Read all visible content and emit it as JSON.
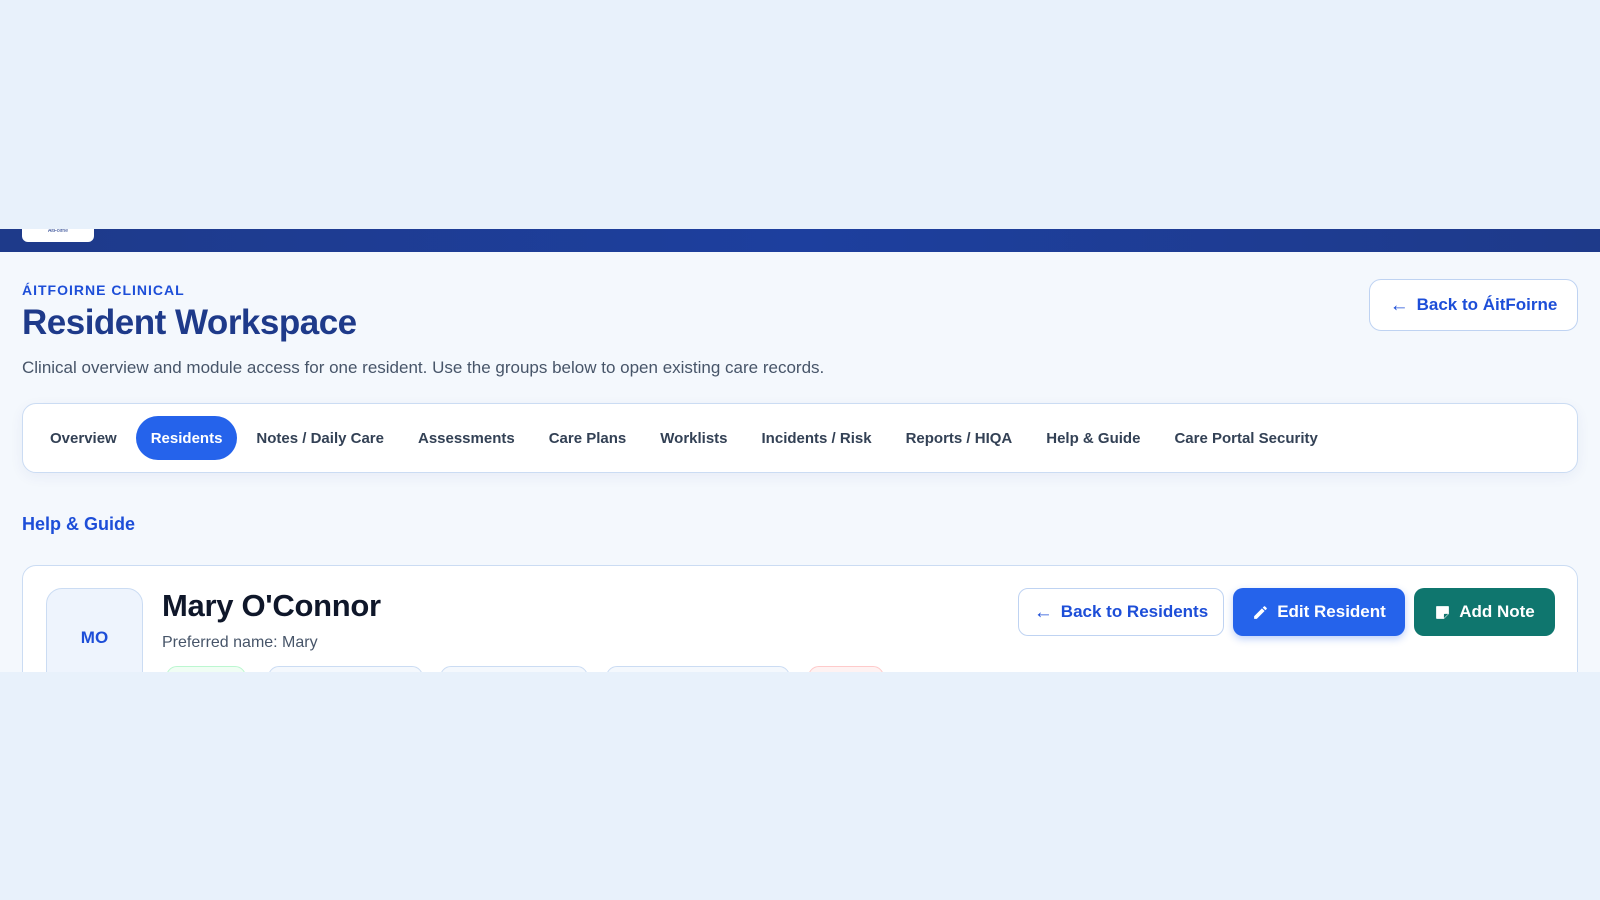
{
  "header": {
    "logo_text": "ÁitFoirne"
  },
  "page": {
    "eyebrow": "ÁITFOIRNE CLINICAL",
    "title": "Resident Workspace",
    "description": "Clinical overview and module access for one resident. Use the groups below to open existing care records.",
    "back_app_label": "Back to ÁitFoirne"
  },
  "nav": {
    "tabs": [
      {
        "label": "Overview"
      },
      {
        "label": "Residents",
        "active": true
      },
      {
        "label": "Notes / Daily Care"
      },
      {
        "label": "Assessments"
      },
      {
        "label": "Care Plans"
      },
      {
        "label": "Worklists"
      },
      {
        "label": "Incidents / Risk"
      },
      {
        "label": "Reports / HIQA"
      },
      {
        "label": "Help & Guide"
      },
      {
        "label": "Care Portal Security"
      }
    ]
  },
  "help_link": "Help & Guide",
  "resident": {
    "initials": "MO",
    "name": "Mary O'Connor",
    "preferred_name": "Preferred name: Mary",
    "back_label": "Back to Residents",
    "edit_label": "Edit Resident",
    "note_label": "Add Note"
  },
  "icons": {
    "back": "arrow-left-icon",
    "edit": "pencil-icon",
    "note": "note-icon"
  },
  "colors": {
    "primary": "#2563eb",
    "navy": "#1e3a8a",
    "teal": "#0f766e",
    "background": "#e8f1fb"
  }
}
